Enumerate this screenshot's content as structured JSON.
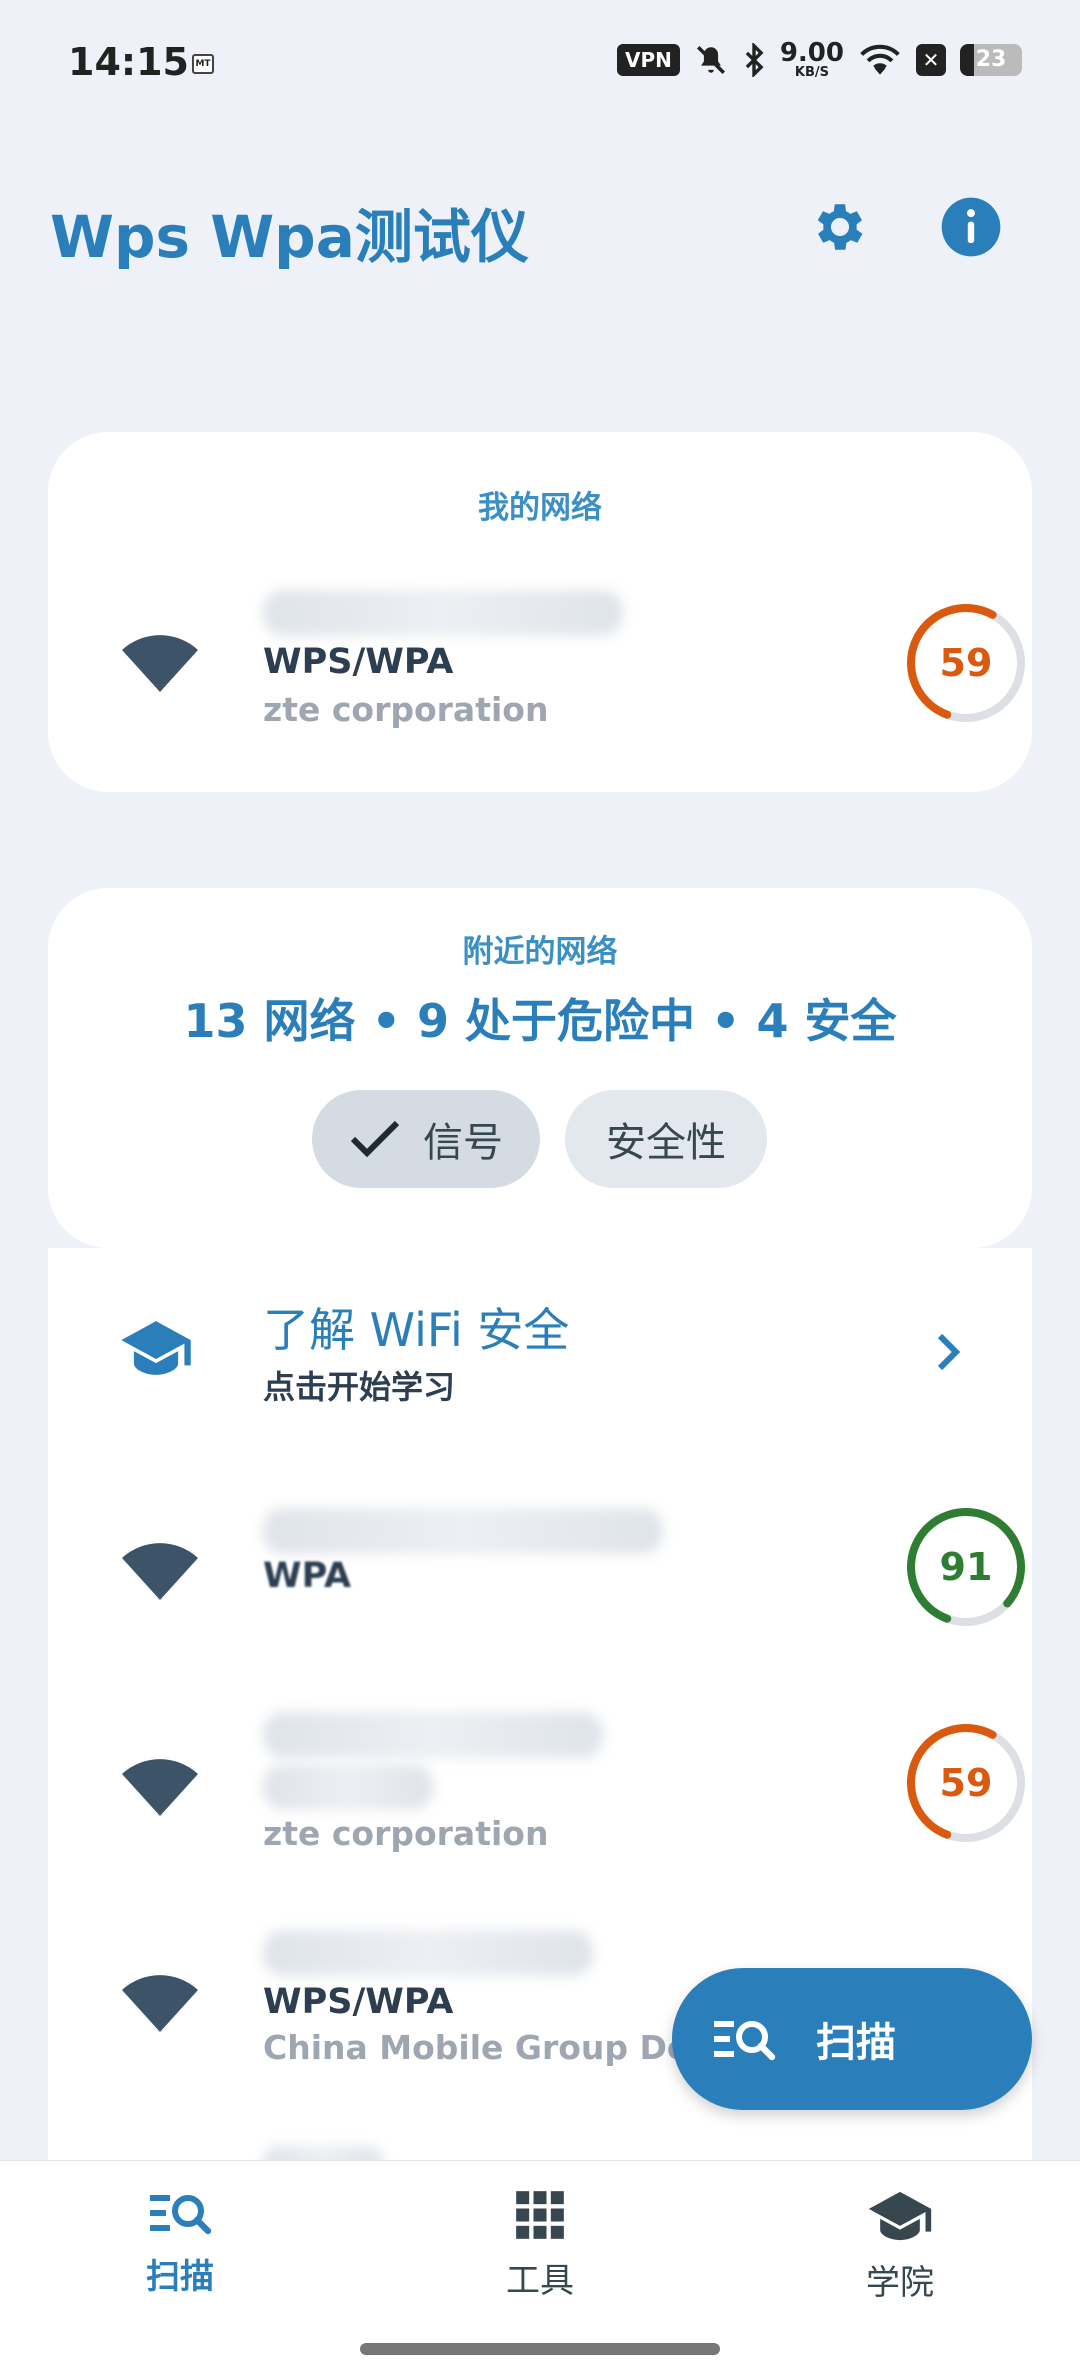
{
  "status_bar": {
    "time": "14:15",
    "app_icon_text": "MT",
    "vpn": "VPN",
    "speed_value": "9.00",
    "speed_unit": "KB/S",
    "battery": "23"
  },
  "header": {
    "title": "Wps Wpa测试仪",
    "settings_icon": "gear-icon",
    "info_icon": "info-icon"
  },
  "my_network": {
    "section_label": "我的网络",
    "security": "WPS/WPA",
    "vendor": "zte corporation",
    "score": 59,
    "score_color": "#d9590f"
  },
  "nearby": {
    "section_label": "附近的网络",
    "summary": "13 网络 • 9 处于危险中 • 4 安全",
    "filters": [
      {
        "label": "信号",
        "selected": true
      },
      {
        "label": "安全性",
        "selected": false
      }
    ]
  },
  "learn": {
    "title": "了解 WiFi 安全",
    "subtitle": "点击开始学习"
  },
  "networks": [
    {
      "security": "WPA",
      "vendor": "",
      "score": 91,
      "score_color": "#2e7d32"
    },
    {
      "security": "",
      "vendor": "zte corporation",
      "score": 59,
      "score_color": "#d9590f"
    },
    {
      "security": "WPS/WPA",
      "vendor": "China Mobile Group De",
      "score": null,
      "score_color": "#d9590f"
    }
  ],
  "fab": {
    "label": "扫描"
  },
  "bottom_nav": [
    {
      "label": "扫描",
      "icon": "scan-search-icon",
      "active": true
    },
    {
      "label": "工具",
      "icon": "grid-icon",
      "active": false
    },
    {
      "label": "学院",
      "icon": "graduation-cap-icon",
      "active": false
    }
  ],
  "colors": {
    "accent": "#2a7fba",
    "background": "#eef2f8",
    "danger": "#d9590f",
    "safe": "#2e7d32"
  }
}
